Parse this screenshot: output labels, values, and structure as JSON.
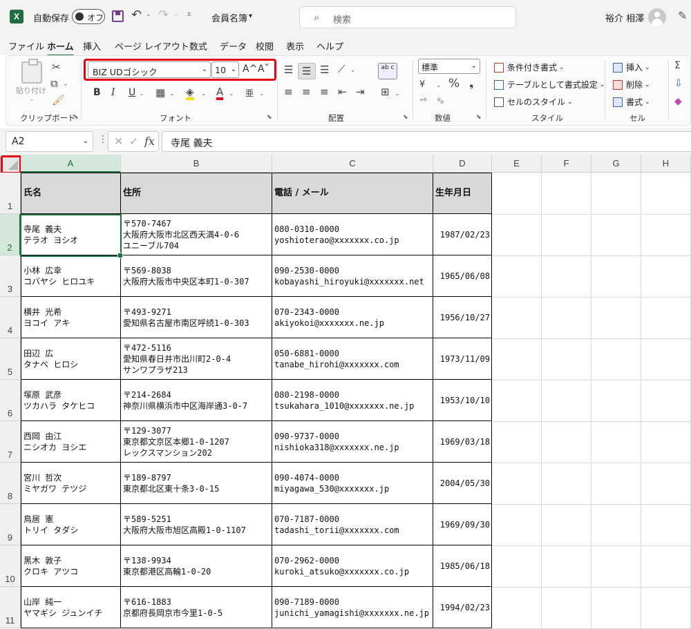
{
  "app": {
    "logo": "X",
    "autosave_label": "自動保存",
    "autosave_state": "オフ",
    "doc_title": "会員名簿",
    "search_placeholder": "検索",
    "user_name": "裕介 相澤"
  },
  "menu_tabs": [
    "ファイル",
    "ホーム",
    "挿入",
    "ページ レイアウト",
    "数式",
    "データ",
    "校閲",
    "表示",
    "ヘルプ"
  ],
  "ribbon": {
    "clipboard": {
      "paste": "貼り付け",
      "group": "クリップボード"
    },
    "font": {
      "name": "BIZ UDゴシック",
      "size": "10",
      "grow": "A^",
      "shrink": "Aˇ",
      "bold": "B",
      "italic": "I",
      "underline": "U",
      "group": "フォント"
    },
    "alignment": {
      "wrap": "ab c",
      "group": "配置"
    },
    "number": {
      "format": "標準",
      "percent": "%",
      "comma": "❟",
      "group": "数値"
    },
    "styles": {
      "conditional": "条件付き書式",
      "table": "テーブルとして書式設定",
      "cell_styles": "セルのスタイル",
      "group": "スタイル"
    },
    "cells": {
      "insert": "挿入",
      "delete": "削除",
      "format": "書式",
      "group": "セル"
    },
    "editing": {
      "sum": "Σ"
    }
  },
  "formula_bar": {
    "name_box": "A2",
    "fx": "fx",
    "content": "寺尾 義夫"
  },
  "sheet": {
    "columns": [
      "A",
      "B",
      "C",
      "D",
      "E",
      "F",
      "G",
      "H"
    ],
    "headers": [
      "氏名",
      "住所",
      "電話 / メール",
      "生年月日"
    ],
    "rows": [
      {
        "num": "2",
        "name": [
          "寺尾 義夫",
          "テラオ ヨシオ"
        ],
        "addr": [
          "〒570-7467",
          "大阪府大阪市北区西天満4-0-6",
          "ユニーブル704"
        ],
        "contact": [
          "080-0310-0000",
          "yoshioterao@xxxxxxx.co.jp"
        ],
        "dob": "1987/02/23"
      },
      {
        "num": "3",
        "name": [
          "小林 広幸",
          "コバヤシ ヒロユキ"
        ],
        "addr": [
          "〒569-8038",
          "大阪府大阪市中央区本町1-0-307"
        ],
        "contact": [
          "090-2530-0000",
          "kobayashi_hiroyuki@xxxxxxx.net"
        ],
        "dob": "1965/06/08"
      },
      {
        "num": "4",
        "name": [
          "横井 光希",
          "ヨコイ アキ"
        ],
        "addr": [
          "〒493-9271",
          "愛知県名古屋市南区呼続1-0-303"
        ],
        "contact": [
          "070-2343-0000",
          "akiyokoi@xxxxxxx.ne.jp"
        ],
        "dob": "1956/10/27"
      },
      {
        "num": "5",
        "name": [
          "田辺 広",
          "タナベ ヒロシ"
        ],
        "addr": [
          "〒472-5116",
          "愛知県春日井市出川町2-0-4",
          "サンワプラザ213"
        ],
        "contact": [
          "050-6881-0000",
          "tanabe_hirohi@xxxxxxx.com"
        ],
        "dob": "1973/11/09"
      },
      {
        "num": "6",
        "name": [
          "塚原 武彦",
          "ツカハラ タケヒコ"
        ],
        "addr": [
          "〒214-2684",
          "神奈川県横浜市中区海岸通3-0-7"
        ],
        "contact": [
          "080-2198-0000",
          "tsukahara_1010@xxxxxxx.ne.jp"
        ],
        "dob": "1953/10/10"
      },
      {
        "num": "7",
        "name": [
          "西岡 由江",
          "ニシオカ ヨシエ"
        ],
        "addr": [
          "〒129-3077",
          "東京都文京区本郷1-0-1207",
          "レックスマンション202"
        ],
        "contact": [
          "090-9737-0000",
          "nishioka318@xxxxxxx.ne.jp"
        ],
        "dob": "1969/03/18"
      },
      {
        "num": "8",
        "name": [
          "宮川 哲次",
          "ミヤガワ テツジ"
        ],
        "addr": [
          "〒189-8797",
          "東京都北区東十条3-0-15"
        ],
        "contact": [
          "090-4074-0000",
          "miyagawa_530@xxxxxxx.jp"
        ],
        "dob": "2004/05/30"
      },
      {
        "num": "9",
        "name": [
          "鳥居 憲",
          "トリイ タダシ"
        ],
        "addr": [
          "〒589-5251",
          "大阪府大阪市旭区高殿1-0-1107"
        ],
        "contact": [
          "070-7187-0000",
          "tadashi_torii@xxxxxxx.com"
        ],
        "dob": "1969/09/30"
      },
      {
        "num": "10",
        "name": [
          "黒木 敦子",
          "クロキ アツコ"
        ],
        "addr": [
          "〒138-9934",
          "東京都港区高輪1-0-20"
        ],
        "contact": [
          "070-2962-0000",
          "kuroki_atsuko@xxxxxxx.co.jp"
        ],
        "dob": "1985/06/18"
      },
      {
        "num": "11",
        "name": [
          "山岸 純一",
          "ヤマギシ ジュンイチ"
        ],
        "addr": [
          "〒616-1883",
          "京都府長岡京市今里1-0-5"
        ],
        "contact": [
          "090-7189-0000",
          "junichi_yamagishi@xxxxxxx.ne.jp"
        ],
        "dob": "1994/02/23"
      }
    ]
  },
  "colors": {
    "accent": "#1d6f42",
    "highlight": "#e60012",
    "header_fill": "#d9d9d9"
  }
}
